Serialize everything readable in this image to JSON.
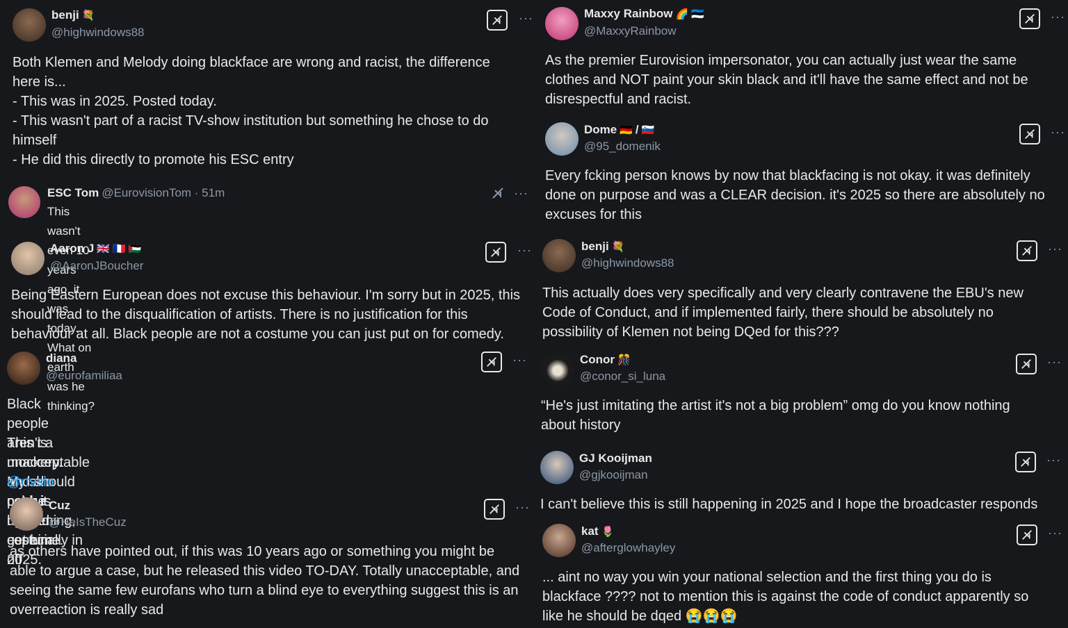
{
  "posts": {
    "benji_top": {
      "name": "benji",
      "handle": "@highwindows88",
      "body": "Both Klemen and Melody doing blackface are wrong and racist, the difference\nhere is...\n- This was in 2025. Posted today.\n- This wasn't part of a racist TV-show institution but something he chose to do\nhimself\n- He did this directly to promote his ESC entry"
    },
    "esc_tom": {
      "name": "ESC Tom",
      "handle": "@EurovisionTom · 51m",
      "body": "This wasn't even 10 years ago, it was today. What on earth was he thinking?"
    },
    "aaron": {
      "name": "Aaron J",
      "handle": "@AaronJBoucher",
      "body": "Being Eastern European does not excuse this behaviour. I'm sorry but in 2025, this\nshould lead to the disqualification of artists. There is no justification for this\nbehaviour at all. Black people are not a costume you can just put on for comedy."
    },
    "diana": {
      "name": "diana",
      "handle": "@eurofamiliaa",
      "body_line1": "Black people aren't a mockery. My skin color is not a costume.",
      "body_line2": "This is unacceptable and should not be happening, especially in 2025.",
      "mention": "@rtvslo",
      "body_line3": " pack it up and get him off"
    },
    "cuz": {
      "name": "Cuz",
      "handle": "@HeIsTheCuz",
      "body": "as others have pointed out, if this was 10 years ago or something you might be\nable to argue a case, but he released this video TO-DAY. Totally unacceptable, and\nseeing the same few eurofans who turn a blind eye to everything suggest this is an\noverreaction is really sad"
    },
    "maxxy": {
      "name": "Maxxy Rainbow",
      "handle": "@MaxxyRainbow",
      "body": "As the premier Eurovision impersonator, you can actually just wear the same\nclothes and NOT paint your skin black and it'll have the same effect and not be\ndisrespectful and racist."
    },
    "dome": {
      "name": "Dome",
      "name_sep": "/",
      "handle": "@95_domenik",
      "body": "Every fcking person knows by now that blackfacing is not okay. it was definitely\ndone on purpose and was a CLEAR decision. it's 2025 so there are absolutely no\nexcuses for this"
    },
    "benji_right": {
      "name": "benji",
      "handle": "@highwindows88",
      "body": "This actually does very specifically and very clearly contravene the EBU's new\nCode of Conduct, and if implemented fairly, there should be absolutely no\npossibility of Klemen not being DQed for this???"
    },
    "conor": {
      "name": "Conor",
      "handle": "@conor_si_luna",
      "body": "“He's just imitating the artist it's not a big problem” omg do you know nothing\nabout history"
    },
    "gj": {
      "name": "GJ Kooijman",
      "handle": "@gjkooijman",
      "body": "I can't believe this is still happening in 2025 and I hope the broadcaster responds"
    },
    "kat": {
      "name": "kat",
      "handle": "@afterglowhayley",
      "body": "... aint no way you win your national selection and the first thing you do is\nblackface ???? not to mention this is against the code of conduct apparently so\nlike he should be dqed 😭😭😭"
    }
  },
  "ui": {
    "more_label": "···"
  },
  "icons": {
    "grok": "grok-icon",
    "more": "more-icon"
  },
  "colors": {
    "background": "#16181c",
    "text": "#e7e9ea",
    "muted": "#8b98a5",
    "link": "#1d9bf0"
  }
}
